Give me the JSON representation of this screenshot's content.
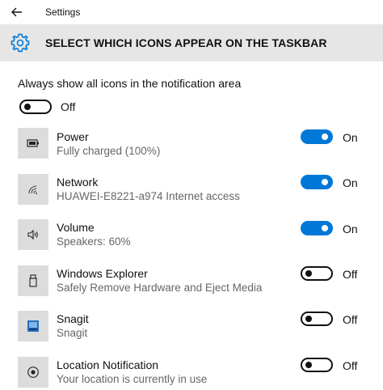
{
  "titlebar": {
    "title": "Settings",
    "back_icon": "back-arrow-icon"
  },
  "header": {
    "title": "SELECT WHICH ICONS APPEAR ON THE TASKBAR",
    "icon": "gear-icon"
  },
  "always_show": {
    "label": "Always show all icons in the notification area",
    "state": "Off",
    "on": false
  },
  "colors": {
    "accent": "#0078d7",
    "tile": "#dcdcdc",
    "header_bg": "#e6e6e6",
    "subtext": "#666666"
  },
  "items": [
    {
      "title": "Power",
      "subtitle": "Fully charged (100%)",
      "state": "On",
      "on": true,
      "icon": "battery-icon"
    },
    {
      "title": "Network",
      "subtitle": "HUAWEI-E8221-a974 Internet access",
      "state": "On",
      "on": true,
      "icon": "wifi-icon"
    },
    {
      "title": "Volume",
      "subtitle": "Speakers: 60%",
      "state": "On",
      "on": true,
      "icon": "speaker-icon"
    },
    {
      "title": "Windows Explorer",
      "subtitle": "Safely Remove Hardware and Eject Media",
      "state": "Off",
      "on": false,
      "icon": "usb-drive-icon"
    },
    {
      "title": "Snagit",
      "subtitle": "Snagit",
      "state": "Off",
      "on": false,
      "icon": "snagit-icon"
    },
    {
      "title": "Location Notification",
      "subtitle": "Your location is currently in use",
      "state": "Off",
      "on": false,
      "icon": "location-icon"
    }
  ]
}
